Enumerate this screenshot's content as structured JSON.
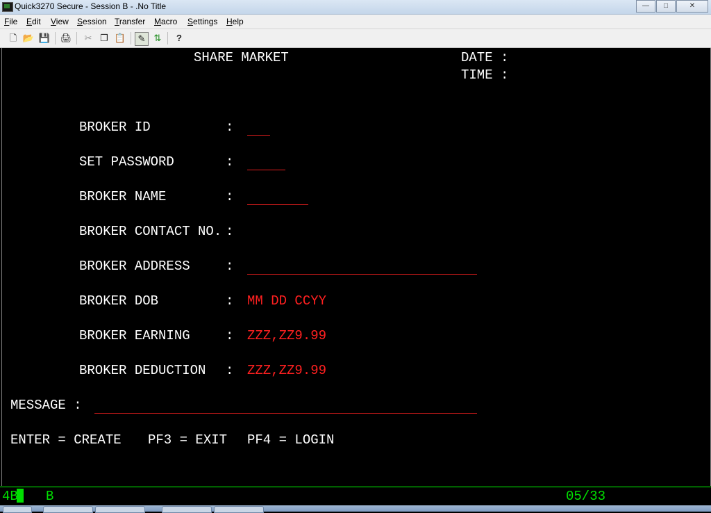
{
  "window": {
    "title": "Quick3270 Secure - Session B - .No Title",
    "minimize_label": "—",
    "restore_label": "□",
    "close_label": "✕"
  },
  "menu": {
    "items": [
      "File",
      "Edit",
      "View",
      "Session",
      "Transfer",
      "Macro",
      "Settings",
      "Help"
    ]
  },
  "toolbar": {
    "buttons": [
      "new-icon",
      "open-icon",
      "save-icon",
      "print-icon",
      "cut-icon",
      "copy-icon",
      "paste-icon",
      "edit-field-icon",
      "transfer-icon",
      "help-icon"
    ],
    "new": "🗋",
    "open": "📂",
    "save": "💾",
    "print": "🖨",
    "cut": "✂",
    "copy": "❐",
    "paste": "📋",
    "edit_field": "✎",
    "transfer": "⇅",
    "help": "?"
  },
  "screen": {
    "header_title": "SHARE MARKET",
    "date_label": "DATE :",
    "time_label": "TIME :",
    "fields": {
      "broker_id": {
        "label": "BROKER ID",
        "colon": ":"
      },
      "set_password": {
        "label": "SET PASSWORD",
        "colon": ":"
      },
      "broker_name": {
        "label": "BROKER NAME",
        "colon": ":"
      },
      "broker_contact": {
        "label": "BROKER CONTACT NO.",
        "colon": ":"
      },
      "broker_address": {
        "label": "BROKER ADDRESS",
        "colon": ":"
      },
      "broker_dob": {
        "label": "BROKER DOB",
        "colon": ":",
        "value": "MM DD CCYY"
      },
      "broker_earning": {
        "label": "BROKER EARNING",
        "colon": ":",
        "value": "ZZZ,ZZ9.99"
      },
      "broker_deduction": {
        "label": "BROKER DEDUCTION",
        "colon": ":",
        "value": "ZZZ,ZZ9.99"
      }
    },
    "message_label": "MESSAGE :",
    "keys": {
      "enter": "ENTER = CREATE",
      "pf3": "PF3 = EXIT",
      "pf4": "PF4 = LOGIN"
    }
  },
  "status_bar": {
    "session_indicator": "4B",
    "session_letter": "B",
    "cursor_position": "05/33"
  },
  "colors": {
    "screen_bg": "#000000",
    "text": "#ffffff",
    "input_field": "#ff2020",
    "status_text": "#00e000"
  }
}
